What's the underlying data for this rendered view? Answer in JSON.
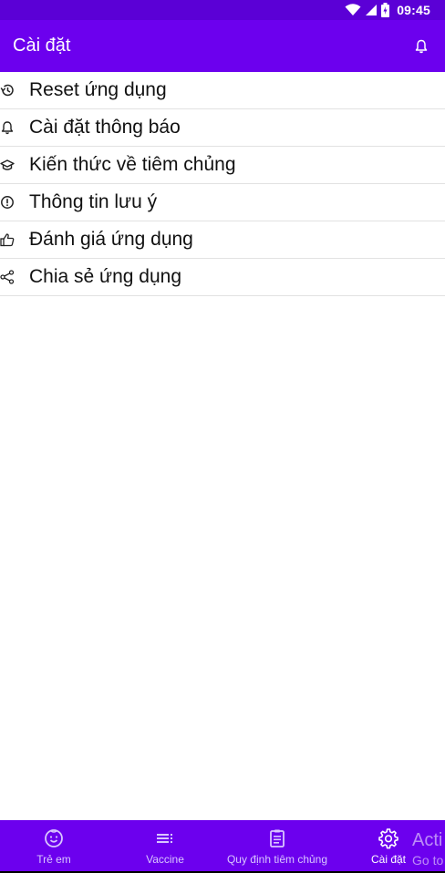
{
  "status_bar": {
    "time": "09:45",
    "icons": [
      "wifi-icon",
      "signal-icon",
      "battery-icon"
    ]
  },
  "app_bar": {
    "title": "Cài đặt",
    "action_icon": "bell-icon"
  },
  "settings": {
    "items": [
      {
        "label": "Reset ứng dụng",
        "icon": "history-icon"
      },
      {
        "label": "Cài đặt thông báo",
        "icon": "bell-icon"
      },
      {
        "label": "Kiến thức về tiêm chủng",
        "icon": "graduation-cap-icon"
      },
      {
        "label": "Thông tin lưu ý",
        "icon": "alert-circle-icon"
      },
      {
        "label": "Đánh giá ứng dụng",
        "icon": "thumbs-up-icon"
      },
      {
        "label": "Chia sẻ ứng dụng",
        "icon": "share-icon"
      }
    ]
  },
  "bottom_nav": {
    "tabs": [
      {
        "label": "Trẻ em",
        "icon": "child-face-icon",
        "active": false
      },
      {
        "label": "Vaccine",
        "icon": "list-icon",
        "active": false
      },
      {
        "label": "Quy định tiêm chủng",
        "icon": "clipboard-icon",
        "active": false
      },
      {
        "label": "Cài đặt",
        "icon": "gear-icon",
        "active": true
      }
    ]
  },
  "watermark": {
    "line1": "Acti",
    "line2": "Go to"
  },
  "colors": {
    "primary": "#6c00ee",
    "status_bar": "#5b00d6",
    "divider": "#e2e2e2",
    "inactive_tab": "#d9c6ff"
  }
}
